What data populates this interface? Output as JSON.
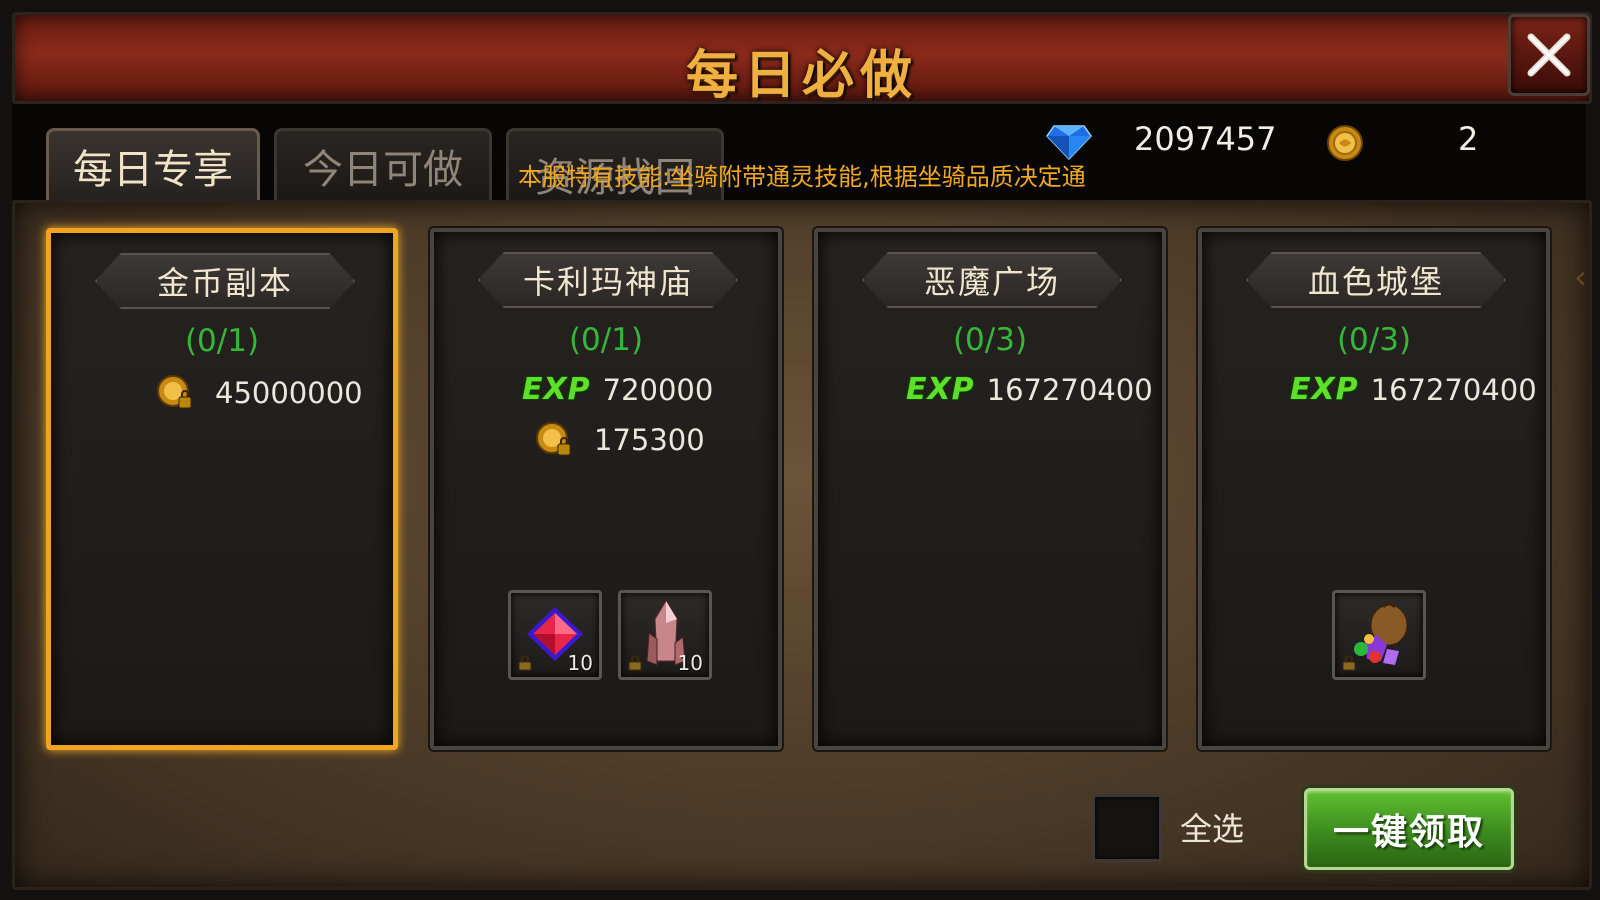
{
  "window": {
    "title": "每日必做"
  },
  "tabs": [
    {
      "label": "每日专享",
      "active": true
    },
    {
      "label": "今日可做",
      "active": false
    },
    {
      "label": "资源找回",
      "active": false
    }
  ],
  "marquee_text": "本服特有技能:坐骑附带通灵技能,根据坐骑品质决定通",
  "resources": {
    "diamond": "2097457",
    "coin": "2"
  },
  "cards": [
    {
      "title": "金币副本",
      "progress": "(0/1)",
      "selected": true,
      "rewards": [
        {
          "type": "coin",
          "value": "45000000"
        }
      ],
      "items": []
    },
    {
      "title": "卡利玛神庙",
      "progress": "(0/1)",
      "selected": false,
      "rewards": [
        {
          "type": "exp",
          "label": "EXP",
          "value": "720000"
        },
        {
          "type": "coin",
          "value": "175300"
        }
      ],
      "items": [
        {
          "icon": "red-gem-icon",
          "count": "10"
        },
        {
          "icon": "crystal-icon",
          "count": "10"
        }
      ]
    },
    {
      "title": "恶魔广场",
      "progress": "(0/3)",
      "selected": false,
      "rewards": [
        {
          "type": "exp",
          "label": "EXP",
          "value": "167270400"
        }
      ],
      "items": []
    },
    {
      "title": "血色城堡",
      "progress": "(0/3)",
      "selected": false,
      "rewards": [
        {
          "type": "exp",
          "label": "EXP",
          "value": "167270400"
        }
      ],
      "items": [
        {
          "icon": "treasure-bag-icon",
          "count": ""
        }
      ]
    }
  ],
  "footer": {
    "select_all_label": "全选",
    "claim_button_label": "一键领取"
  },
  "colors": {
    "accent_gold": "#f0b040",
    "progress_green": "#35b83a",
    "exp_green": "#5ee02a",
    "selected_border": "#f2a320",
    "claim_button": "#3c8a1e"
  }
}
